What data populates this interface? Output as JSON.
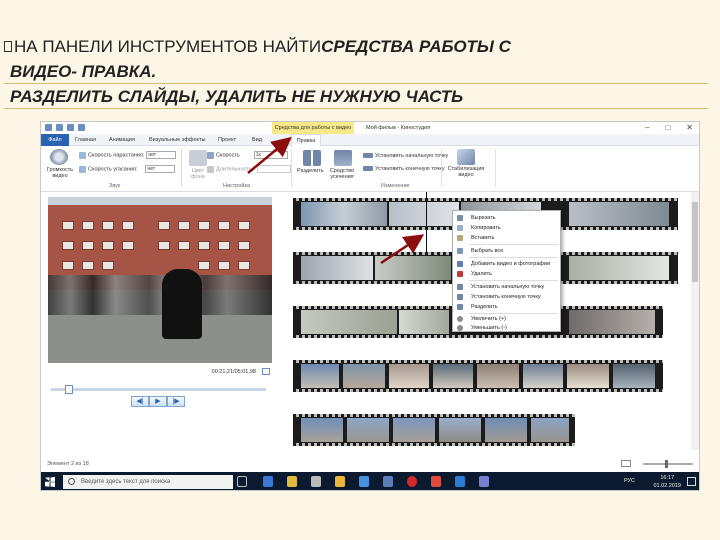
{
  "slide": {
    "heading_line1_prefix": "НА ПАНЕЛИ ИНСТРУМЕНТОВ НАЙТИ ",
    "heading_line1_emphasis": "СРЕДСТВА РАБОТЫ С",
    "heading_line2": "ВИДЕО-  ПРАВКА.",
    "heading_line3": "РАЗДЕЛИТЬ СЛАЙДЫ, УДАЛИТЬ НЕ  НУЖНУЮ ЧАСТЬ"
  },
  "window": {
    "contextual_tab_group": "Средства для работы с видео",
    "title": "Мой фильм - Киностудия",
    "controls": [
      "–",
      "□",
      "✕"
    ]
  },
  "tabs": [
    "Файл",
    "Главная",
    "Анимация",
    "Визуальные эффекты",
    "Проект",
    "Вид",
    "Правка"
  ],
  "ribbon": {
    "volume_label": "Громкость видео",
    "fade_in_label": "Скорость нарастания:",
    "fade_in_value": "нет",
    "fade_out_label": "Скорость угасания:",
    "fade_out_value": "нет",
    "bg_color_label": "Цвет фона",
    "speed_label": "Скорость",
    "speed_value": "1x",
    "duration_label": "Длительность:",
    "split_label": "Разделить",
    "trim_label": "Средство усечения",
    "set_start_label": "Установить начальную точку",
    "set_end_label": "Установить конечную точку",
    "stabilize_label": "Стабилизация видео",
    "groups": [
      "Звук",
      "Настройка",
      "Изменение"
    ]
  },
  "player": {
    "time": "00:21,21/05:01,98",
    "buttons": [
      "◀|",
      "▶",
      "|▶"
    ]
  },
  "context_menu": [
    "Вырезать",
    "Копировать",
    "Вставить",
    "Выбрать все",
    "Добавить видео и фотографии",
    "Удалить",
    "Установить начальную точку",
    "Установить конечную точку",
    "Разделить",
    "Увеличить (+)",
    "Уменьшить (-)"
  ],
  "status": {
    "text": "Элемент 2 из 18"
  },
  "taskbar": {
    "search_placeholder": "Введите здесь текст для поиска",
    "lang": "РУС",
    "time": "16:17",
    "date": "01.02.2019"
  },
  "colors": {
    "slide_bg": "#fcf6e6",
    "accent": "#2a63b4",
    "contextual_tab": "#f7e98a",
    "arrow": "#8b0d0d"
  }
}
